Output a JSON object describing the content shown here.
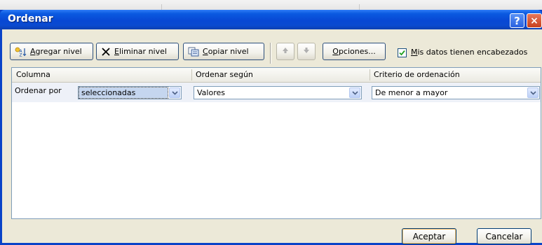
{
  "window": {
    "title": "Ordenar",
    "help_glyph": "?",
    "close_glyph": "×"
  },
  "toolbar": {
    "add_level": {
      "label_u": "A",
      "label_rest": "gregar nivel",
      "icon": "add-level-icon"
    },
    "delete_level": {
      "label_u": "E",
      "label_rest": "liminar nivel",
      "icon": "delete-x-icon"
    },
    "copy_level": {
      "label_u": "C",
      "label_rest": "opiar nivel",
      "icon": "copy-icon"
    },
    "move_up_icon": "arrow-up-icon",
    "move_down_icon": "arrow-down-icon",
    "options": {
      "label_u": "O",
      "label_rest": "pciones..."
    },
    "headers_checkbox": {
      "checked": true,
      "label_u": "M",
      "label_rest": "is datos tienen encabezados"
    }
  },
  "grid": {
    "headers": [
      "Columna",
      "Ordenar según",
      "Criterio de ordenación"
    ],
    "rows": [
      {
        "label": "Ordenar por",
        "column": "seleccionadas",
        "sort_on": "Valores",
        "order": "De menor a mayor"
      }
    ]
  },
  "footer": {
    "accept": "Aceptar",
    "cancel": "Cancelar"
  },
  "colors": {
    "titlebar": "#0a4ad0",
    "dialog_bg": "#ece9d8",
    "row_bg": "#eef1f8",
    "border": "#7f9db9"
  }
}
